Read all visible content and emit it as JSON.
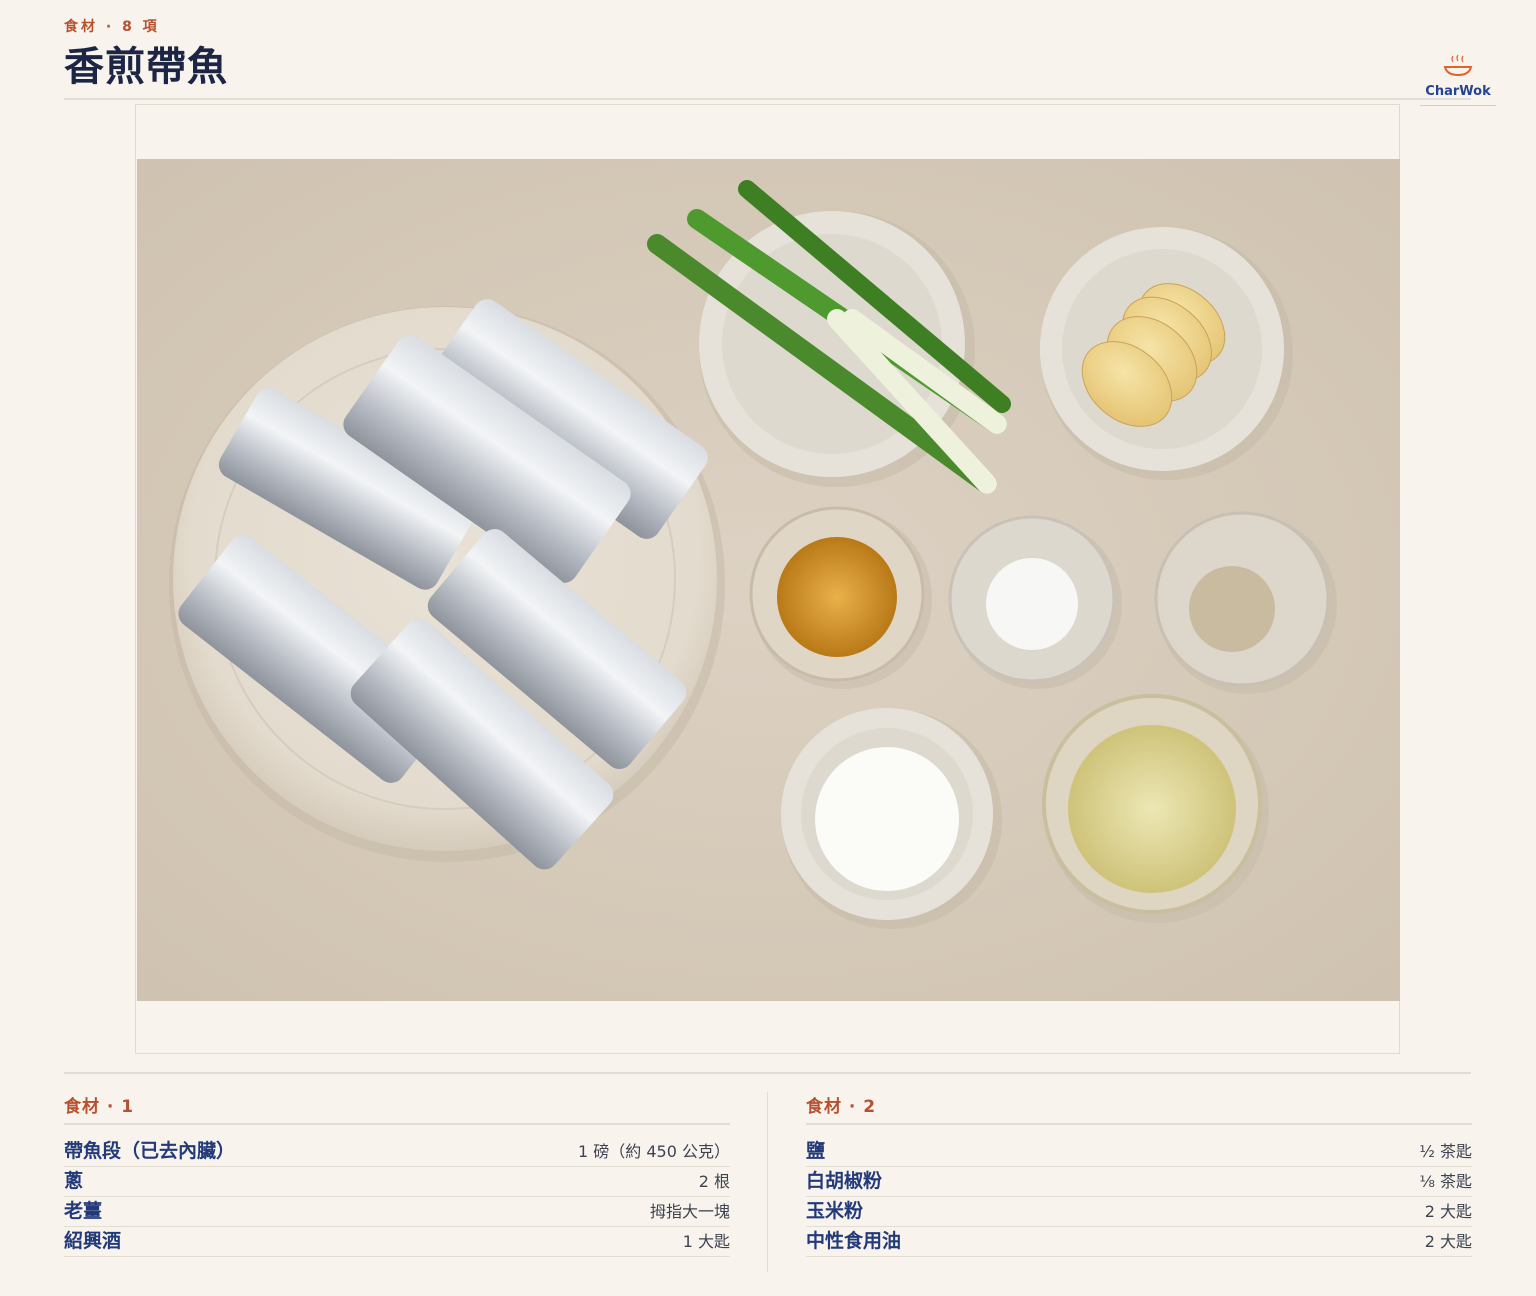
{
  "header": {
    "eyebrow": "食材 · 8 項",
    "title": "香煎帶魚"
  },
  "brand": {
    "name": "CharWok",
    "icon": "steaming-bowl-icon",
    "color": "#244392",
    "accent": "#e2622a"
  },
  "photo": {
    "items": [
      "ribbonfish-plate",
      "scallion-bowl",
      "ginger-bowl",
      "shaoxing-wine-bowl",
      "salt-bowl",
      "white-pepper-bowl",
      "cornstarch-bowl",
      "oil-bowl"
    ]
  },
  "sections": [
    {
      "heading": "食材 · 1",
      "items": [
        {
          "name": "帶魚段（已去內臟）",
          "qty": "1 磅（約 450 公克）"
        },
        {
          "name": "蔥",
          "qty": "2 根"
        },
        {
          "name": "老薑",
          "qty": "拇指大一塊"
        },
        {
          "name": "紹興酒",
          "qty": "1 大匙"
        }
      ]
    },
    {
      "heading": "食材 · 2",
      "items": [
        {
          "name": "鹽",
          "qty": "½ 茶匙"
        },
        {
          "name": "白胡椒粉",
          "qty": "⅛ 茶匙"
        },
        {
          "name": "玉米粉",
          "qty": "2 大匙"
        },
        {
          "name": "中性食用油",
          "qty": "2 大匙"
        }
      ]
    }
  ],
  "colors": {
    "accent": "#b5512f",
    "ingredient": "#233a7a",
    "background": "#f8f4ed"
  }
}
